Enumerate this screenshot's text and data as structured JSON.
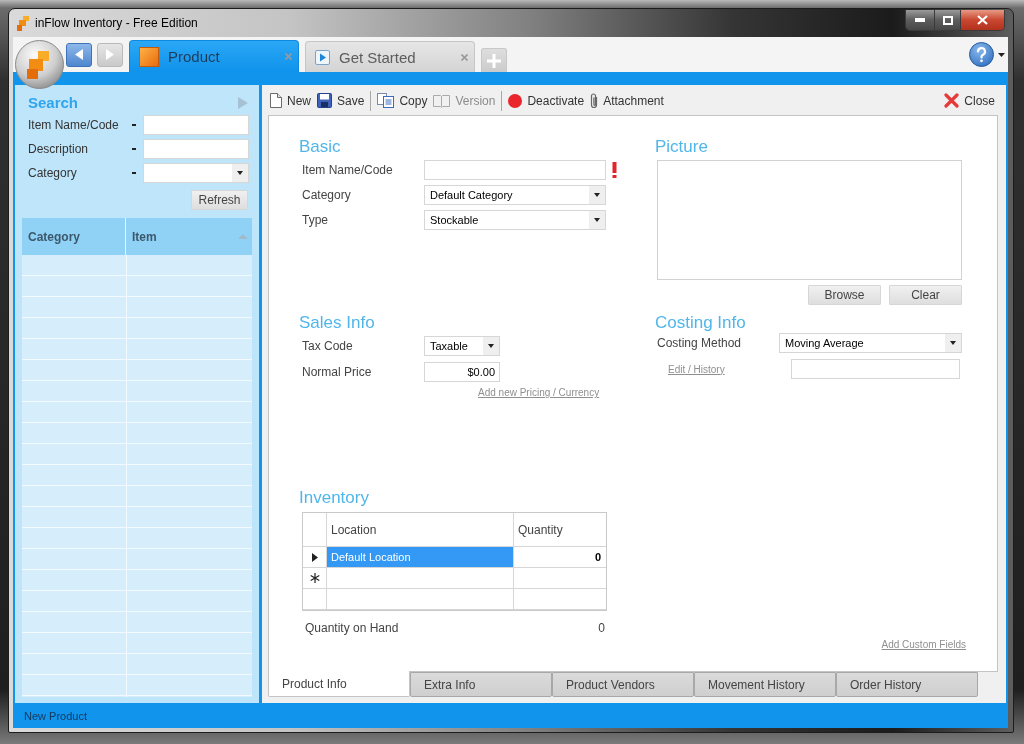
{
  "window": {
    "title": "inFlow Inventory - Free Edition"
  },
  "navigation": [
    {
      "kind": "back",
      "disabled": false
    },
    {
      "kind": "forward",
      "disabled": true
    }
  ],
  "document_tabs": [
    {
      "label": "Product",
      "kind": "product",
      "selected": true
    },
    {
      "label": "Get Started",
      "kind": "start",
      "selected": false
    }
  ],
  "search": {
    "title": "Search",
    "fields": [
      {
        "label": "Item Name/Code",
        "kind": "text"
      },
      {
        "label": "Description",
        "kind": "text"
      },
      {
        "label": "Category",
        "kind": "dropdown"
      }
    ],
    "refresh_button": "Refresh",
    "columns": [
      {
        "label": "Category",
        "sorted": false
      },
      {
        "label": "Item",
        "sorted": true
      }
    ]
  },
  "toolbar": {
    "groups": [
      {
        "items": [
          {
            "label": "New",
            "kind": "new",
            "disabled": false
          },
          {
            "label": "Save",
            "kind": "save",
            "disabled": false
          }
        ]
      },
      {
        "items": [
          {
            "label": "Copy",
            "kind": "copy",
            "disabled": false
          },
          {
            "label": "Version",
            "kind": "version",
            "disabled": true
          }
        ]
      },
      {
        "items": [
          {
            "label": "Deactivate",
            "kind": "deactivate",
            "disabled": false
          },
          {
            "label": "Attachment",
            "kind": "attachment",
            "disabled": false
          }
        ]
      }
    ],
    "close": "Close"
  },
  "basic": {
    "title": "Basic",
    "fields": [
      {
        "label": "Item Name/Code",
        "kind": "text",
        "required": true
      },
      {
        "label": "Category",
        "kind": "dropdown",
        "value": "Default Category",
        "required": false
      },
      {
        "label": "Type",
        "kind": "dropdown",
        "value": "Stockable",
        "required": false
      }
    ]
  },
  "picture": {
    "title": "Picture",
    "buttons": [
      "Browse",
      "Clear"
    ]
  },
  "sales_info": {
    "title": "Sales Info",
    "fields": [
      {
        "label": "Tax Code",
        "kind": "dropdown",
        "value": "Taxable"
      },
      {
        "label": "Normal Price",
        "kind": "amount",
        "value": "$0.00"
      }
    ],
    "link": "Add new Pricing / Currency"
  },
  "costing_info": {
    "title": "Costing Info",
    "fields": [
      {
        "label": "Costing Method",
        "kind": "dropdown",
        "value": "Moving Average"
      },
      {
        "label": "Edit / History",
        "kind": "link_text"
      }
    ]
  },
  "inventory": {
    "title": "Inventory",
    "columns": [
      "Location",
      "Quantity"
    ],
    "rows": [
      {
        "kind": "current",
        "location": "Default Location",
        "quantity": "0",
        "selected": true
      },
      {
        "kind": "new",
        "selected": false
      },
      {
        "kind": "blank",
        "selected": false
      }
    ],
    "total_label": "Quantity on Hand",
    "total_value": "0"
  },
  "custom_fields_link": "Add Custom Fields",
  "bottom_tabs": [
    {
      "label": "Product Info",
      "selected": true
    },
    {
      "label": "Extra Info",
      "selected": false
    },
    {
      "label": "Product Vendors",
      "selected": false
    },
    {
      "label": "Movement History",
      "selected": false
    },
    {
      "label": "Order History",
      "selected": false
    }
  ],
  "status_bar": {
    "text": "New Product"
  }
}
